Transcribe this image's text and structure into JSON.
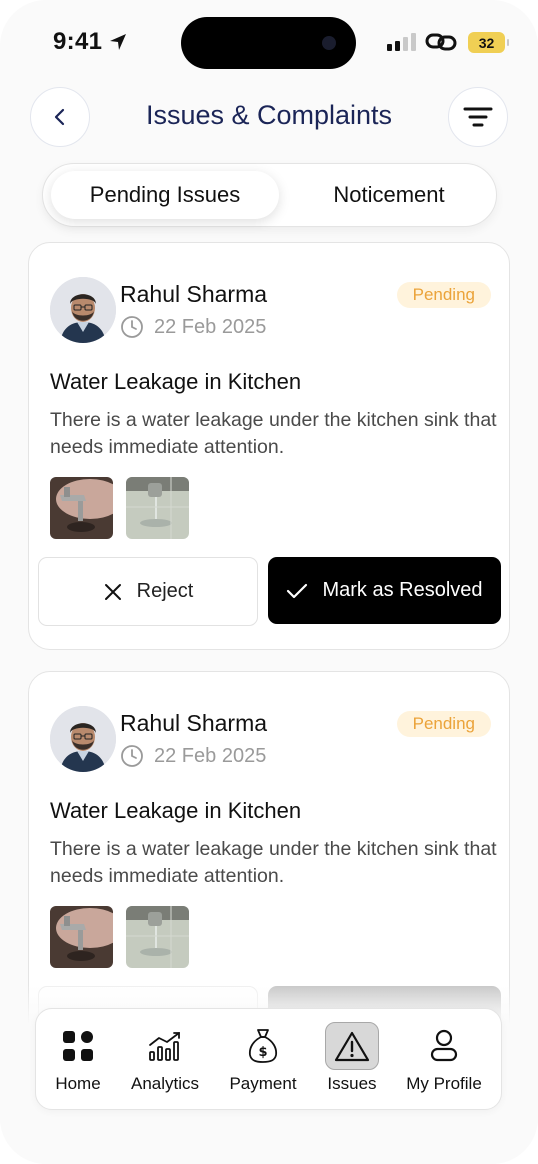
{
  "status_bar": {
    "time": "9:41",
    "battery": "32"
  },
  "header": {
    "title": "Issues & Complaints"
  },
  "tabs": [
    {
      "label": "Pending Issues"
    },
    {
      "label": "Noticement"
    }
  ],
  "issues": [
    {
      "name": "Rahul Sharma",
      "date": "22 Feb 2025",
      "status": "Pending",
      "title": "Water Leakage in Kitchen",
      "description": "There is a water leakage under the kitchen sink that needs immediate attention.",
      "reject_label": "Reject",
      "resolve_label": "Mark as Resolved"
    },
    {
      "name": "Rahul Sharma",
      "date": "22 Feb 2025",
      "status": "Pending",
      "title": "Water Leakage in Kitchen",
      "description": "There is a water leakage under the kitchen sink that needs immediate attention."
    }
  ],
  "colors": {
    "pending_text": "#eba33a",
    "pending_bg": "#fff3dc",
    "title_text": "#1b2557",
    "primary_button": "#000000"
  },
  "nav": [
    {
      "label": "Home",
      "icon": "home-grid-icon"
    },
    {
      "label": "Analytics",
      "icon": "analytics-chart-icon"
    },
    {
      "label": "Payment",
      "icon": "money-bag-icon"
    },
    {
      "label": "Issues",
      "icon": "warning-icon",
      "active": true
    },
    {
      "label": "My Profile",
      "icon": "profile-icon"
    }
  ]
}
